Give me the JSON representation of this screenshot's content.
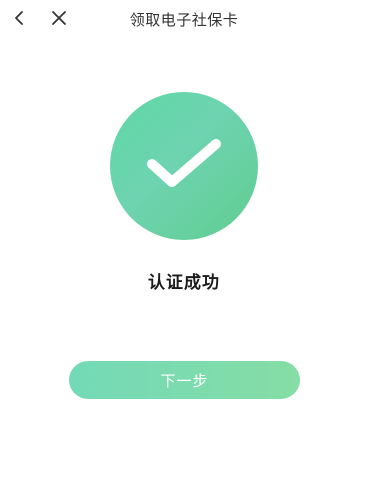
{
  "header": {
    "title": "领取电子社保卡",
    "back_icon": "chevron-left-icon",
    "close_icon": "close-icon"
  },
  "status": {
    "icon": "checkmark-icon",
    "message": "认证成功"
  },
  "actions": {
    "next_label": "下一步"
  },
  "colors": {
    "accent_green": "#5fd8a7",
    "button_gradient_start": "#73d9b8",
    "button_gradient_end": "#86dda5",
    "title_text": "#333333",
    "status_text": "#1b1b1b"
  }
}
